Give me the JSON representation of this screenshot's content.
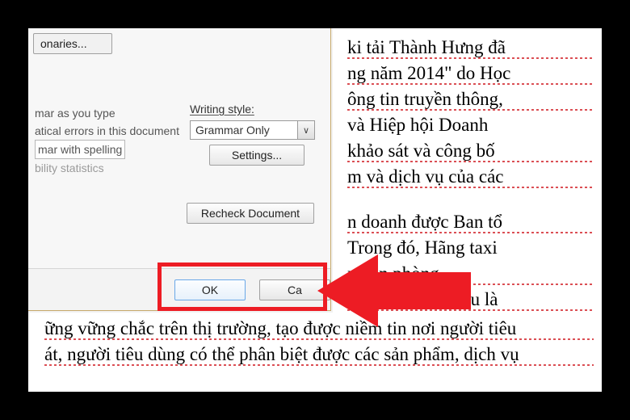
{
  "dialog": {
    "custom_dictionaries_label": "onaries...",
    "writing_style_label": "Writing style:",
    "writing_style_value": "Grammar Only",
    "settings_label": "Settings...",
    "recheck_label": "Recheck Document",
    "ok_label": "OK",
    "cancel_label": "Ca",
    "opts": {
      "line1": "mar as you type",
      "line2": "atical errors in this document",
      "line3": "mar with spelling",
      "line4": "bility statistics"
    }
  },
  "doc": {
    "l1": "ki tải Thành Hưng đã",
    "l2": "ng năm 2014\" do Học",
    "l3": "ông tin truyền thông,",
    "l4": "và Hiệp hội Doanh",
    "l5": "khảo sát và công bố",
    "l6": "m và dịch vụ của các",
    "l7": "n doanh được Ban tổ",
    "l8": "Trong đó, Hãng taxi",
    "l9": "n văn phòng",
    "l10": "gia bình chọn đều là",
    "l11": "ững vững chắc trên thị trường, tạo được niềm tin nơi người tiêu",
    "l12": "át, người tiêu dùng có thể phân biệt được các sản phẩm, dịch vụ"
  }
}
